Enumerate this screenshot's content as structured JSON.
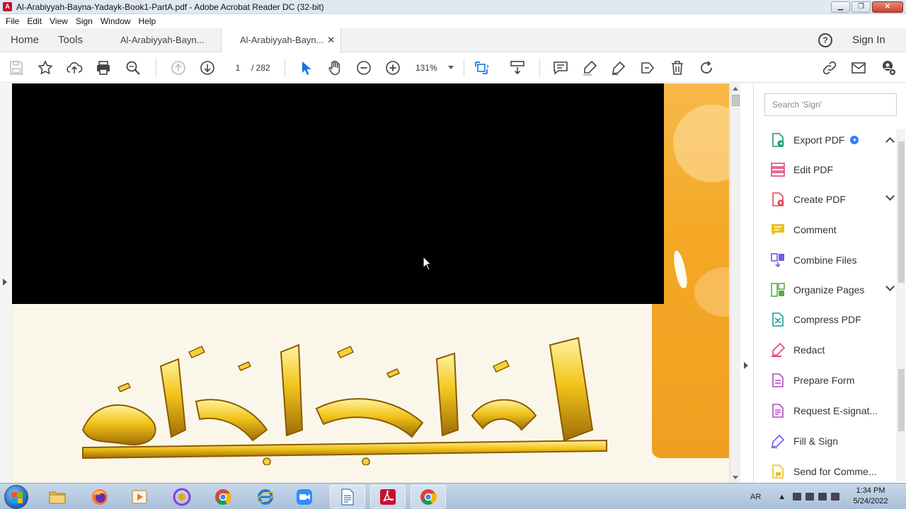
{
  "window": {
    "title": "Al-Arabiyyah-Bayna-Yadayk-Book1-PartA.pdf - Adobe Acrobat Reader DC (32-bit)",
    "minimize": "▁",
    "restore": "❐",
    "close": "✕"
  },
  "menu": {
    "items": [
      "File",
      "Edit",
      "View",
      "Sign",
      "Window",
      "Help"
    ]
  },
  "tabs": {
    "home": "Home",
    "tools": "Tools",
    "documents": [
      {
        "label": "Al-Arabiyyah-Bayn...",
        "active": false
      },
      {
        "label": "Al-Arabiyyah-Bayn...",
        "active": true,
        "close": "✕"
      }
    ],
    "help": "?",
    "sign_in": "Sign In"
  },
  "toolbar": {
    "current_page": "1",
    "total_pages": "/ 282",
    "zoom": "131%"
  },
  "tools_pane": {
    "search_placeholder": "Search 'Sign'",
    "items": [
      {
        "label": "Export PDF",
        "icon": "export-pdf-icon",
        "color": "#1b9a6d",
        "badge": "✦",
        "chevron": "up"
      },
      {
        "label": "Edit PDF",
        "icon": "edit-pdf-icon",
        "color": "#e0457b"
      },
      {
        "label": "Create PDF",
        "icon": "create-pdf-icon",
        "color": "#e34850",
        "chevron": "down"
      },
      {
        "label": "Comment",
        "icon": "comment-icon",
        "color": "#e8c225"
      },
      {
        "label": "Combine Files",
        "icon": "combine-files-icon",
        "color": "#6e5ce7"
      },
      {
        "label": "Organize Pages",
        "icon": "organize-pages-icon",
        "color": "#58b03c",
        "chevron": "down"
      },
      {
        "label": "Compress PDF",
        "icon": "compress-pdf-icon",
        "color": "#1b9a9a"
      },
      {
        "label": "Redact",
        "icon": "redact-icon",
        "color": "#e0457b"
      },
      {
        "label": "Prepare Form",
        "icon": "prepare-form-icon",
        "color": "#b845c8"
      },
      {
        "label": "Request E-signat...",
        "icon": "request-esign-icon",
        "color": "#b845c8"
      },
      {
        "label": "Fill & Sign",
        "icon": "fill-sign-icon",
        "color": "#6e5ce7"
      },
      {
        "label": "Send for Comme...",
        "icon": "send-comment-icon",
        "color": "#e8c225"
      }
    ]
  },
  "taskbar": {
    "language": "AR",
    "time": "1:34 PM",
    "date": "5/24/2022"
  },
  "colors": {
    "acrobat_red": "#c8102e",
    "selection_blue": "#1473e6",
    "page_orange": "#f4a826"
  }
}
